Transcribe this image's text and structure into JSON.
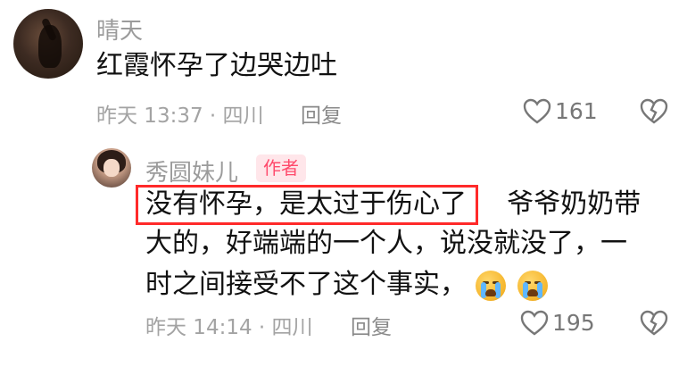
{
  "comment1": {
    "username": "晴天",
    "text": "红霞怀孕了边哭边吐",
    "meta": "昨天 13:37 · 四川",
    "reply_label": "回复",
    "likes": "161"
  },
  "comment2": {
    "username": "秀圆妹儿",
    "badge": "作者",
    "text_highlight": "没有怀孕，是太过于伤心了",
    "text_line1_rest": "爷爷奶奶带",
    "text_line2": "大的，好端端的一个人，说没就没了，一",
    "text_line3": "时之间接受不了这个事实，",
    "meta": "昨天 14:14 · 四川",
    "reply_label": "回复",
    "likes": "195"
  },
  "colors": {
    "highlight_border": "#ff2a2a",
    "badge_bg": "#ffe6ea",
    "badge_text": "#ff4a6c"
  },
  "icons": [
    "heart-outline-icon",
    "broken-heart-icon",
    "crying-face-emoji"
  ]
}
